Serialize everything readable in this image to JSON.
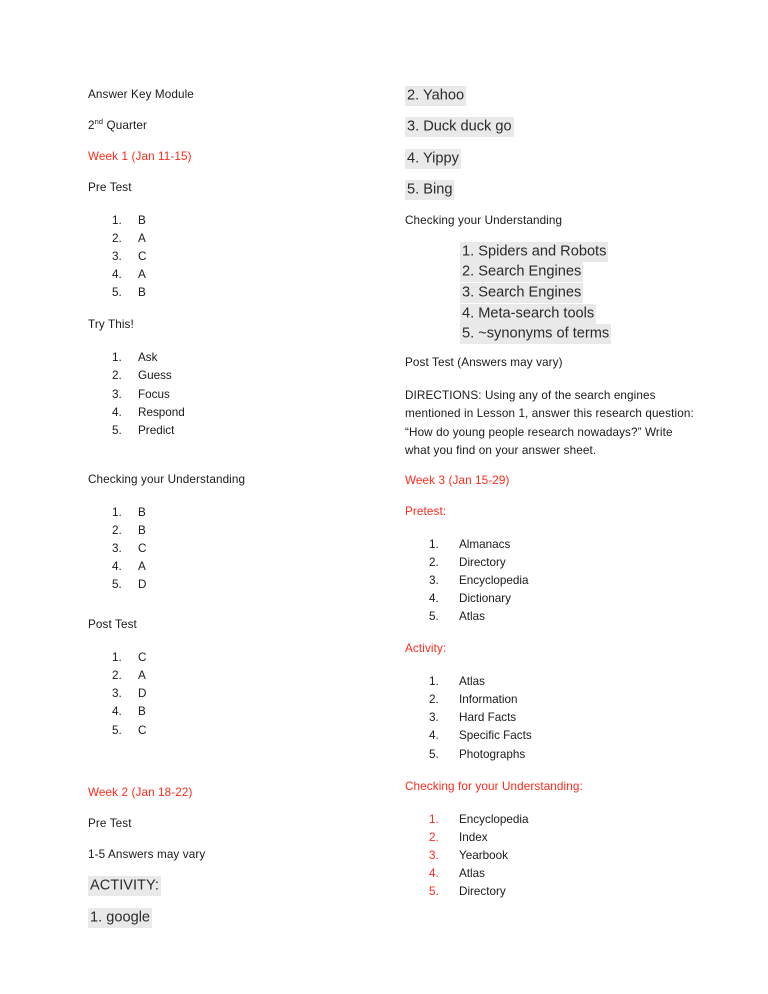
{
  "document": {
    "title": "Answer Key Module",
    "quarter_prefix": "2",
    "quarter_sup": "nd",
    "quarter_suffix": " Quarter",
    "accent_red": "#fc2a1c",
    "highlight_gray": "#e9e9e9",
    "text_color": "#1a1a1a"
  },
  "left_column": {
    "week1": {
      "heading": "Week 1 (Jan 11-15)",
      "pre_test_label": "Pre Test",
      "pre_test_answers": [
        "B",
        "A",
        "C",
        "A",
        "B"
      ],
      "try_this_label": "Try This!",
      "try_this_answers": [
        "Ask",
        "Guess",
        "Focus",
        "Respond",
        "Predict"
      ],
      "checking_label": "Checking your Understanding",
      "checking_answers": [
        "B",
        "B",
        "C",
        "A",
        "D"
      ],
      "post_test_label": "Post Test",
      "post_test_answers": [
        "C",
        "A",
        "D",
        "B",
        "C"
      ]
    },
    "week2": {
      "heading": "Week 2 (Jan 18-22)",
      "pre_test_label": "Pre Test",
      "pre_test_note": "1-5 Answers may vary",
      "activity_label": "ACTIVITY:",
      "activity_item_1": "1. google"
    }
  },
  "right_column": {
    "week2_continued": {
      "activity_items": [
        "2. Yahoo",
        "3. Duck duck go",
        "4. Yippy",
        "5. Bing"
      ],
      "checking_label": "Checking your Understanding",
      "checking_answers": [
        "1. Spiders and Robots",
        "2. Search Engines",
        "3. Search Engines",
        "4. Meta-search tools",
        "5. ~synonyms of terms"
      ],
      "post_test_label": "Post Test  (Answers may vary)",
      "directions": "DIRECTIONS: Using any of the search engines mentioned in Lesson 1, answer this research question: “How do young people research nowadays?” Write what you find on your answer sheet."
    },
    "week3": {
      "heading": "Week 3 (Jan 15-29)",
      "pretest_label": "Pretest:",
      "pretest_answers": [
        "Almanacs",
        "Directory",
        "Encyclopedia",
        "Dictionary",
        "Atlas"
      ],
      "activity_label": "Activity:",
      "activity_answers": [
        "Atlas",
        "Information",
        "Hard Facts",
        "Specific Facts",
        "Photographs"
      ],
      "checking_label": "Checking for your Understanding:",
      "checking_answers": [
        "Encyclopedia",
        "Index",
        "Yearbook",
        "Atlas",
        "Directory"
      ]
    }
  },
  "numbers": [
    "1.",
    "2.",
    "3.",
    "4.",
    "5."
  ]
}
